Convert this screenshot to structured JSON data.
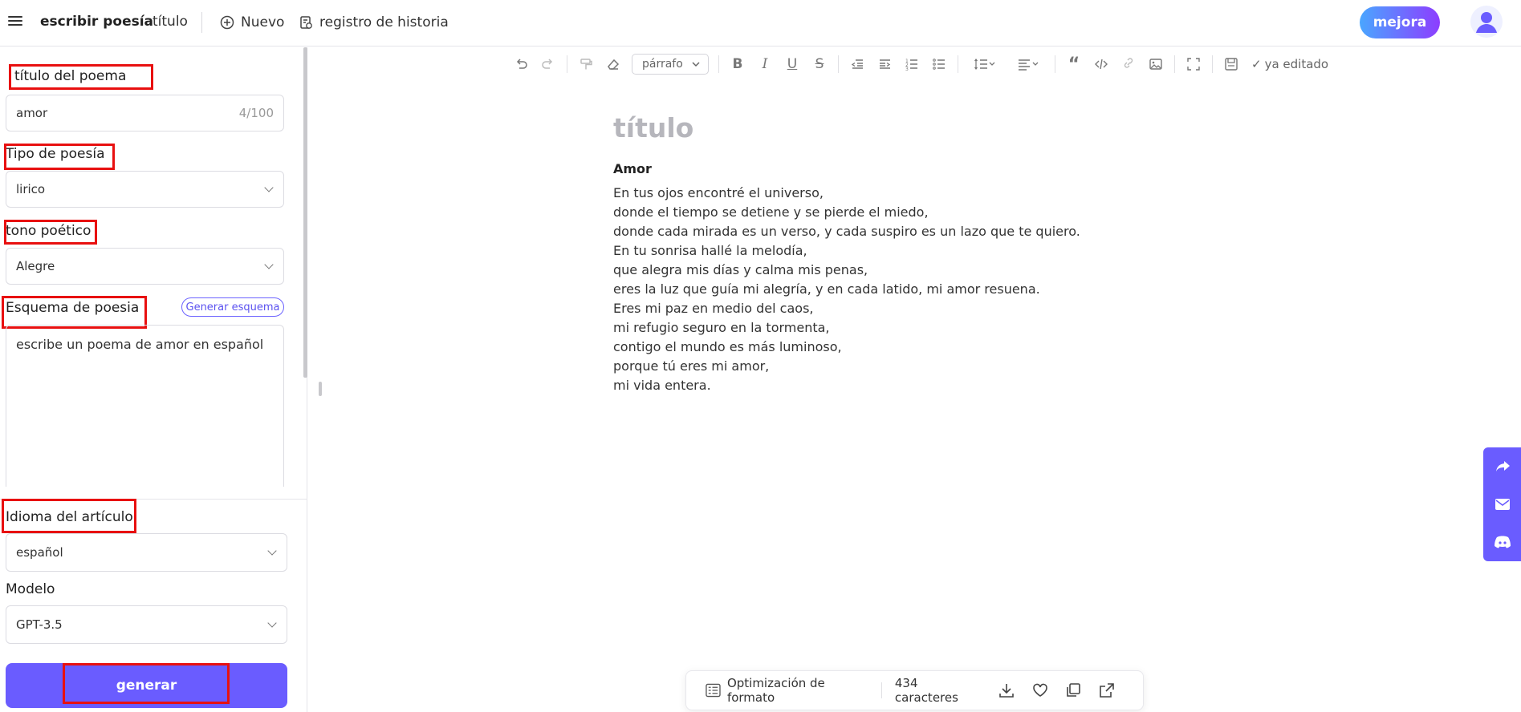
{
  "header": {
    "app_name": "escribir poesía",
    "title_link": "título",
    "new_button": "Nuevo",
    "history_button": "registro de historia",
    "upgrade_button": "mejora"
  },
  "form": {
    "title_label": "título del poema",
    "title_value": "amor",
    "title_count": "4/100",
    "type_label": "Tipo de poesía",
    "type_value": "lirico",
    "tone_label": "tono poético",
    "tone_value": "Alegre",
    "schema_label": "Esquema de poesia",
    "schema_button": "Generar esquema",
    "schema_value": "escribe un poema de amor en español",
    "language_label": "Idioma del artículo",
    "language_value": "español",
    "model_label": "Modelo",
    "model_value": "GPT-3.5",
    "generate_button": "generar"
  },
  "toolbar": {
    "paragraph_select": "párrafo",
    "edited_status": "ya editado",
    "bold": "B",
    "italic": "I",
    "underline": "U",
    "strike": "S"
  },
  "editor": {
    "doc_title_placeholder": "título",
    "poem_title": "Amor",
    "lines": [
      "En tus ojos encontré el universo,",
      "donde el tiempo se detiene y se pierde el miedo,",
      "donde cada mirada es un verso, y cada suspiro es un lazo que te quiero.",
      "En tu sonrisa hallé la melodía,",
      "que alegra mis días y calma mis penas,",
      "eres la luz que guía mi alegría, y en cada latido, mi amor resuena.",
      "Eres mi paz en medio del caos,",
      "mi refugio seguro en la tormenta,",
      "contigo el mundo es más luminoso,",
      "porque tú eres mi amor,",
      "mi vida entera."
    ]
  },
  "bottom_bar": {
    "format_optimization": "Optimización de formato",
    "char_count": "434 caracteres"
  },
  "colors": {
    "accent": "#6a5cff",
    "highlight_box": "#e81010",
    "upgrade_gradient_start": "#4aa6ff",
    "upgrade_gradient_end": "#8d3dff"
  }
}
